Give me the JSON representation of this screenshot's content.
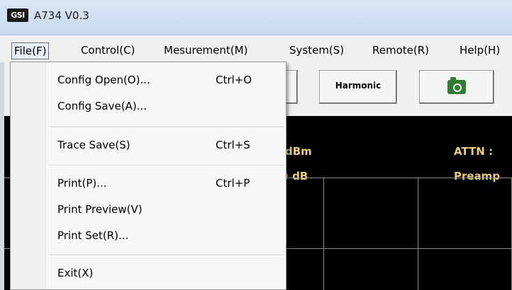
{
  "window": {
    "logo_text": "GSI",
    "title": "A734 V0.3"
  },
  "menubar": {
    "items": [
      {
        "label": "File(F)",
        "name": "menu-file"
      },
      {
        "label": "Control(C)",
        "name": "menu-control"
      },
      {
        "label": "Mesurement(M)",
        "name": "menu-mesurement"
      },
      {
        "label": "System(S)",
        "name": "menu-system"
      },
      {
        "label": "Remote(R)",
        "name": "menu-remote"
      },
      {
        "label": "Help(H)",
        "name": "menu-help"
      }
    ]
  },
  "toolbar": {
    "harmonic_label": "Harmonic",
    "camera_icon": "camera-icon"
  },
  "display": {
    "readout_left_1": "dBm",
    "readout_left_2": ") dB",
    "readout_right_1": "ATTN :",
    "readout_right_2": "Preamp"
  },
  "file_menu": {
    "config_open": {
      "label": "Config Open(O)...",
      "shortcut": "Ctrl+O"
    },
    "config_save": {
      "label": "Config Save(A)..."
    },
    "trace_save": {
      "label": "Trace Save(S)",
      "shortcut": "Ctrl+S"
    },
    "print": {
      "label": "Print(P)...",
      "shortcut": "Ctrl+P"
    },
    "print_preview": {
      "label": "Print Preview(V)"
    },
    "print_set": {
      "label": "Print Set(R)..."
    },
    "exit": {
      "label": "Exit(X)"
    }
  },
  "colors": {
    "display_background": "#000000",
    "readout_text": "#e8cf7a",
    "grid": "#8a8a8a",
    "camera_icon": "#2f7d2f"
  }
}
